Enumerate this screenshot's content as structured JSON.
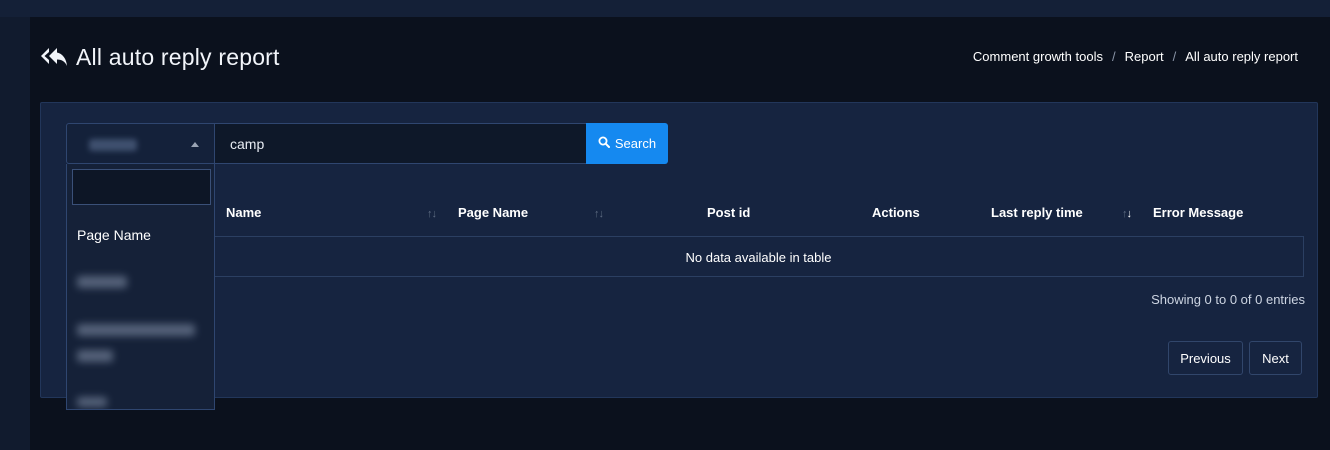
{
  "header": {
    "title": "All auto reply report",
    "icon": "reply-all-icon"
  },
  "breadcrumb": [
    "Comment growth tools",
    "Report",
    "All auto reply report"
  ],
  "filter": {
    "search_value": "camp",
    "search_button_label": "Search",
    "search_icon": "search-icon"
  },
  "dropdown": {
    "first_option": "Page Name"
  },
  "table": {
    "columns": [
      "Name",
      "Page Name",
      "Post id",
      "Actions",
      "Last reply time",
      "Error Message"
    ],
    "empty_message": "No data available in table",
    "info": "Showing 0 to 0 of 0 entries"
  },
  "pagination": {
    "previous_label": "Previous",
    "next_label": "Next"
  },
  "colors": {
    "accent": "#1589f0",
    "card_background": "#162440",
    "page_background": "#0b111d"
  }
}
